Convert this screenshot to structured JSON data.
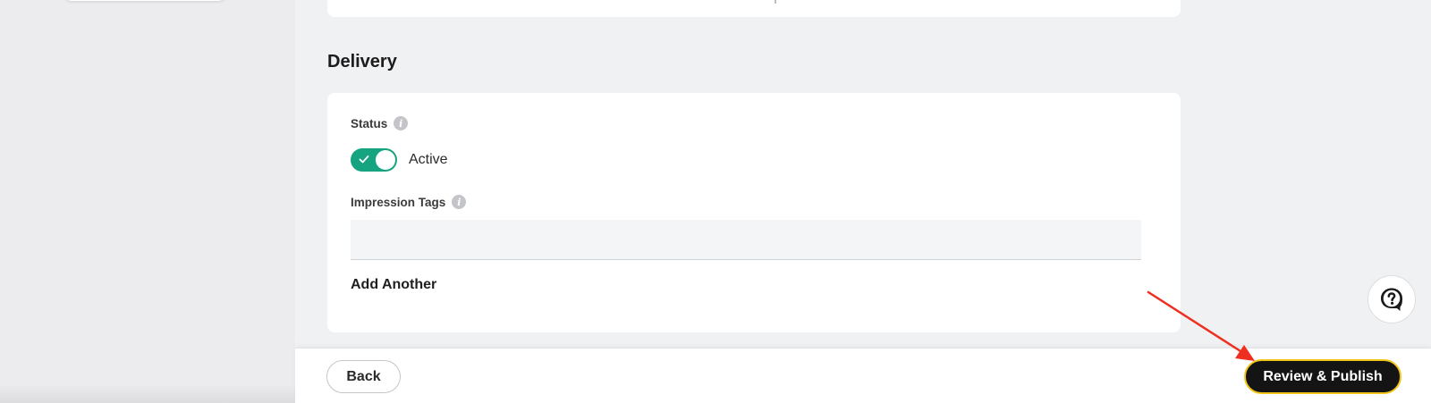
{
  "delivery": {
    "title": "Delivery",
    "status": {
      "label": "Status",
      "info_icon": "info-icon",
      "toggle_state": "on",
      "toggle_text": "Active"
    },
    "impression_tags": {
      "label": "Impression Tags",
      "info_icon": "info-icon",
      "value": "",
      "placeholder": ""
    },
    "add_another_label": "Add Another"
  },
  "footer": {
    "back_label": "Back",
    "publish_label": "Review & Publish"
  },
  "help": {
    "icon": "help-chat-icon"
  },
  "annotation": {
    "icon": "red-arrow",
    "color": "#ee2e1f"
  },
  "colors": {
    "toggle_on": "#16a37f",
    "publish_bg": "#141414",
    "publish_border": "#f0c419"
  }
}
